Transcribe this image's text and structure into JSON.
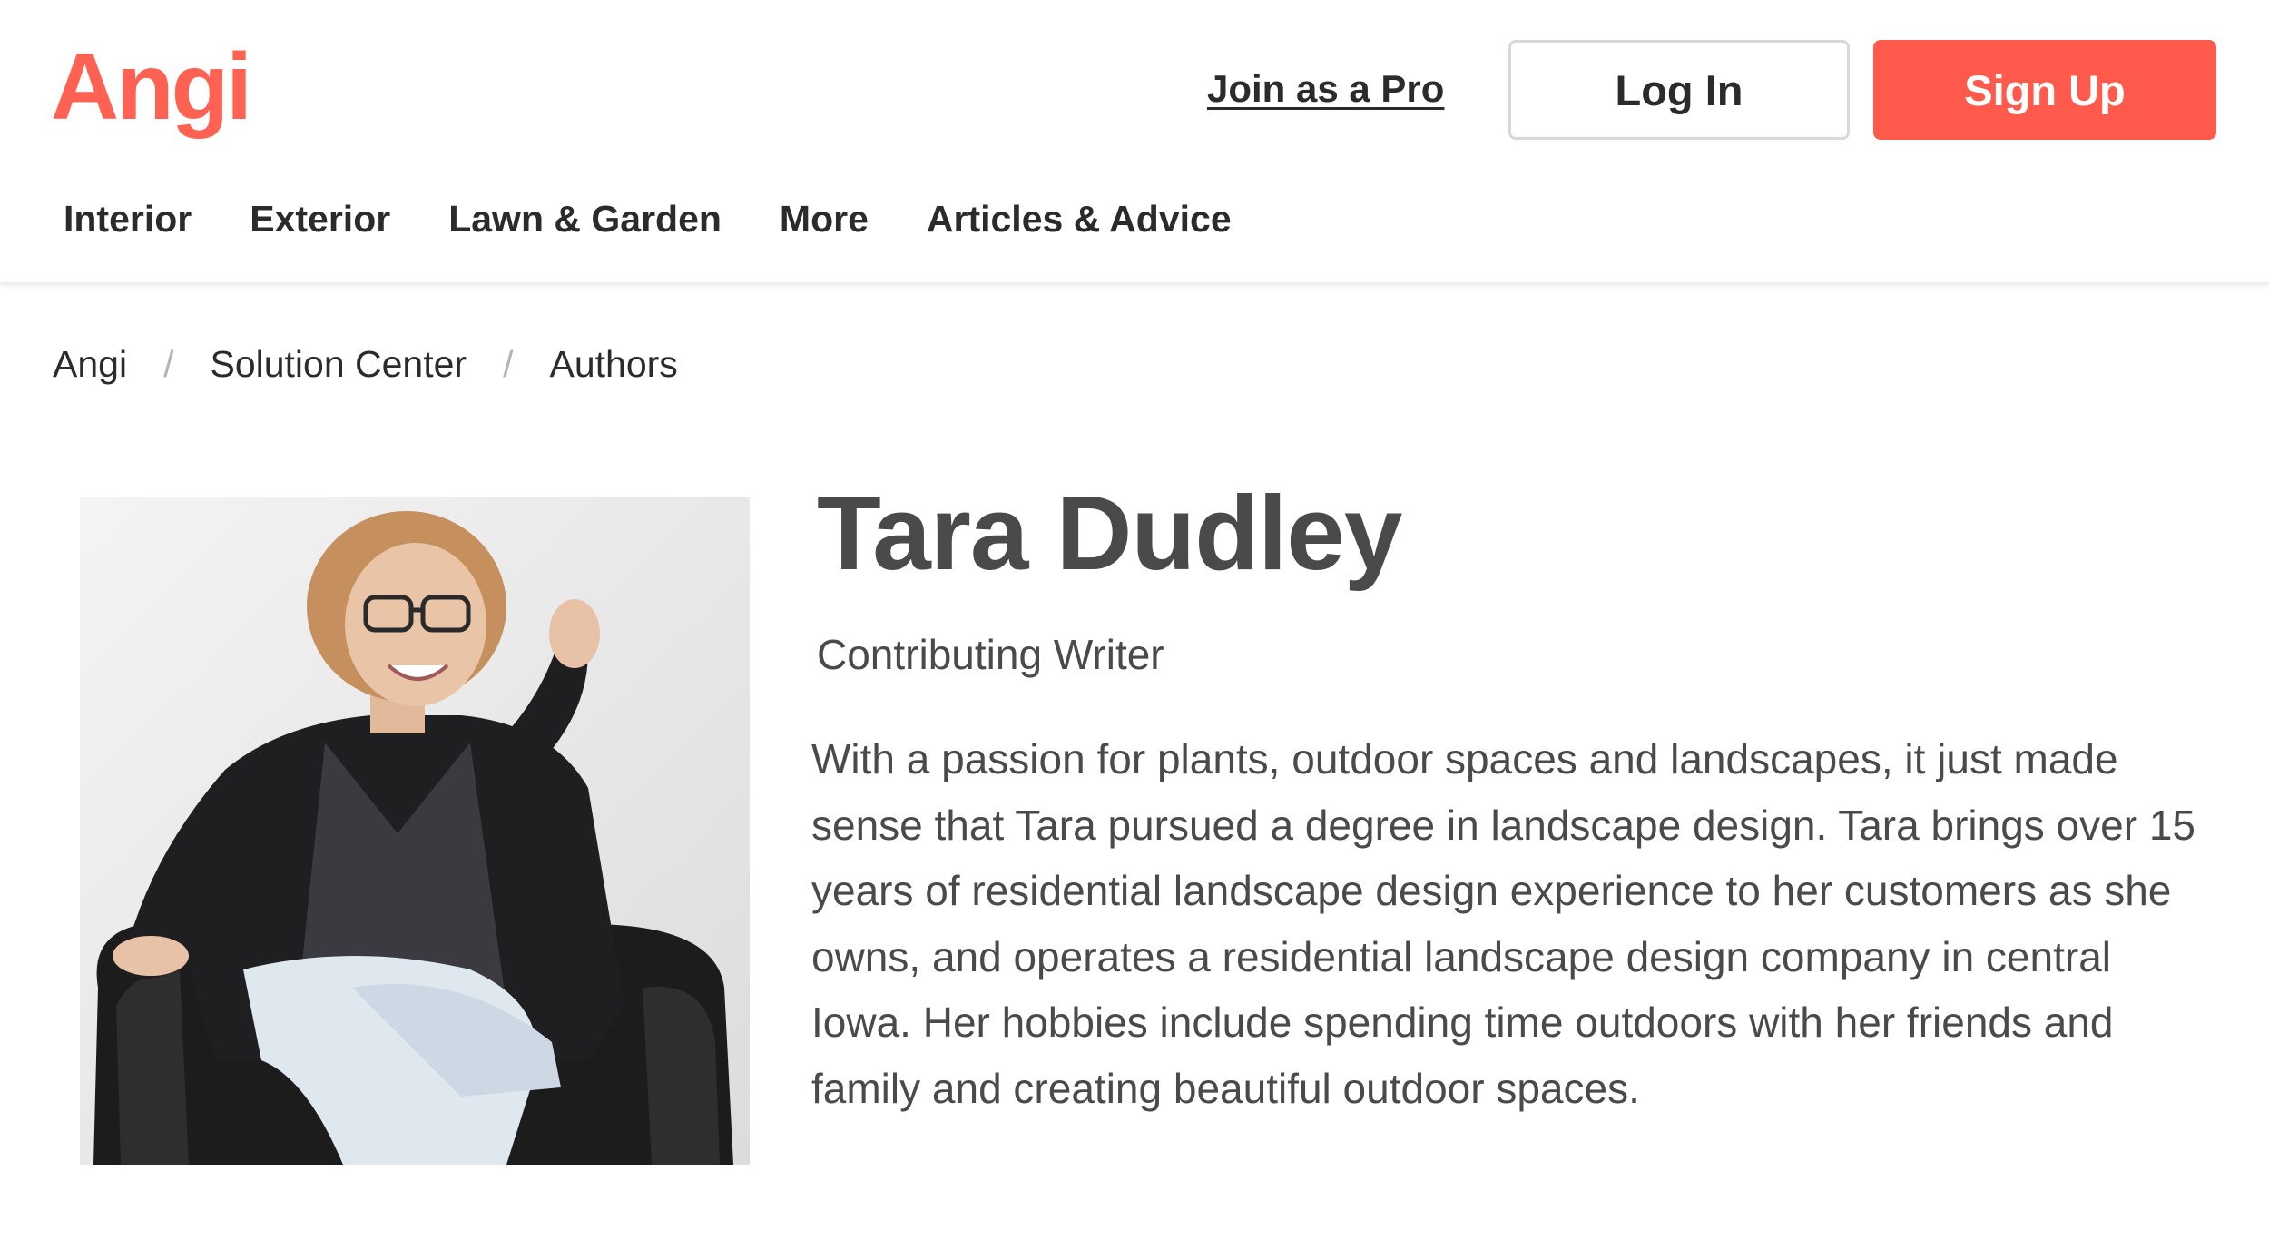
{
  "header": {
    "logo_text": "Angi",
    "brand_color": "#ff6153",
    "join_pro_label": "Join as a Pro",
    "login_label": "Log In",
    "signup_label": "Sign Up",
    "signup_color": "#ff5a4c"
  },
  "nav": {
    "items": [
      {
        "label": "Interior"
      },
      {
        "label": "Exterior"
      },
      {
        "label": "Lawn & Garden"
      },
      {
        "label": "More"
      },
      {
        "label": "Articles & Advice"
      }
    ]
  },
  "breadcrumb": {
    "items": [
      {
        "label": "Angi"
      },
      {
        "label": "Solution Center"
      },
      {
        "label": "Authors"
      }
    ],
    "separator": "/"
  },
  "author": {
    "name": "Tara Dudley",
    "role": "Contributing Writer",
    "bio": "With a passion for plants, outdoor spaces and landscapes, it just made sense that Tara pursued a degree in landscape design. Tara brings over 15 years of residential landscape design experience to her customers as she owns, and operates a residential landscape design company in central Iowa. Her hobbies include spending time outdoors with her friends and family and creating beautiful outdoor spaces."
  }
}
